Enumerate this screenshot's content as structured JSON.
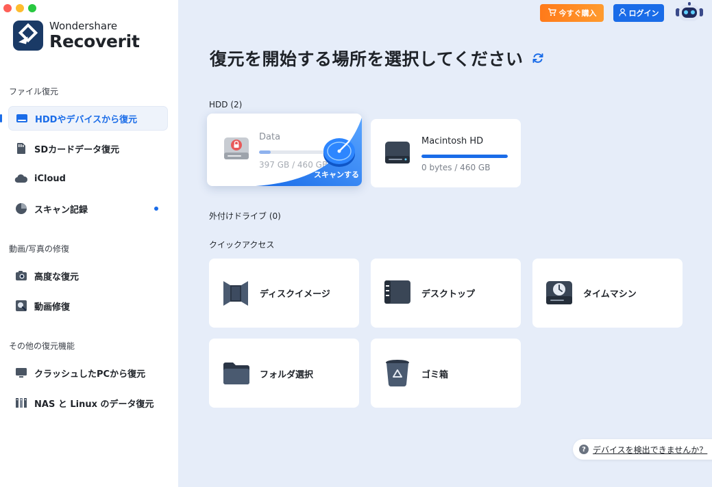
{
  "app": {
    "brand_line1": "Wondershare",
    "brand_line2": "Recoverit"
  },
  "sidebar": {
    "sections": [
      {
        "title": "ファイル復元",
        "items": [
          {
            "label": "HDDやデバイスから復元",
            "icon": "hard-drive-icon",
            "active": true
          },
          {
            "label": "SDカードデータ復元",
            "icon": "sd-card-icon"
          },
          {
            "label": "iCloud",
            "icon": "cloud-icon"
          },
          {
            "label": "スキャン記録",
            "icon": "pie-chart-icon",
            "badge_dot": true
          }
        ]
      },
      {
        "title": "動画/写真の修復",
        "items": [
          {
            "label": "高度な復元",
            "icon": "camera-icon"
          },
          {
            "label": "動画修復",
            "icon": "video-repair-icon"
          }
        ]
      },
      {
        "title": "その他の復元機能",
        "items": [
          {
            "label": "クラッシュしたPCから復元",
            "icon": "monitor-icon"
          },
          {
            "label": "NAS と Linux のデータ復元",
            "icon": "nas-icon"
          }
        ]
      }
    ]
  },
  "header": {
    "buy_label": "今すぐ購入",
    "login_label": "ログイン"
  },
  "main": {
    "title": "復元を開始する場所を選択してください",
    "hdd_group": "HDD (2)",
    "drives": [
      {
        "name": "Data",
        "size": "397 GB / 460 GB",
        "usage": 0.12,
        "hover_action": "スキャンする"
      },
      {
        "name": "Macintosh HD",
        "size": "0 bytes / 460 GB",
        "usage": 1.0
      }
    ],
    "external_group": "外付けドライブ (0)",
    "quick_group": "クイックアクセス",
    "quick_items": [
      {
        "label": "ディスクイメージ",
        "icon": "disk-image-icon"
      },
      {
        "label": "デスクトップ",
        "icon": "desktop-icon"
      },
      {
        "label": "タイムマシン",
        "icon": "time-machine-icon"
      },
      {
        "label": "フォルダ選択",
        "icon": "folder-icon"
      },
      {
        "label": "ゴミ箱",
        "icon": "trash-icon"
      }
    ]
  },
  "help": {
    "text": "デバイスを検出できませんか？"
  },
  "colors": {
    "accent": "#1a6ce8",
    "buy": "#ff8a24",
    "main_bg": "#e6edf9"
  }
}
